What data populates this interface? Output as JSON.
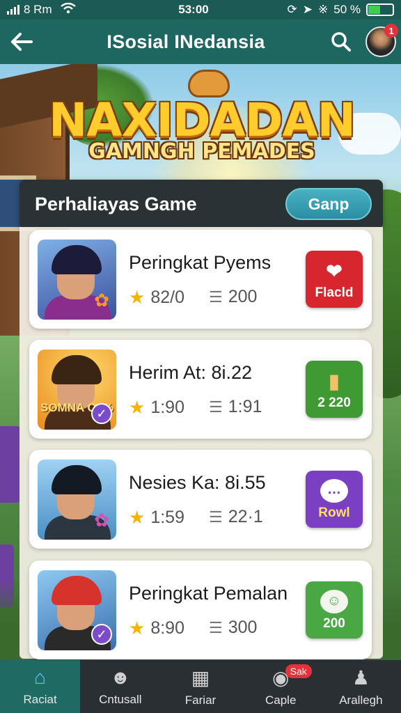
{
  "status_bar": {
    "carrier": "8 Rm",
    "time": "53:00",
    "battery": "50 %",
    "battery_level": 0.5
  },
  "app_bar": {
    "title": "ISosial INedansia",
    "notification_count": "1"
  },
  "banner": {
    "title": "NAXIDADAN",
    "subtitle": "GAMNGH PEMADES"
  },
  "search": {
    "label": "Perhaliayas Game",
    "button": "Ganp"
  },
  "games": [
    {
      "title": "Peringkat Pyems",
      "rating": "82/0",
      "count": "200",
      "action_label": "Flacld",
      "action_color": "#d8262e",
      "thumb_caption": ""
    },
    {
      "title": "Herim At: 8i.22",
      "rating": "1:90",
      "count": "1:91",
      "action_label": "2 220",
      "action_color": "#3f9a34",
      "thumb_caption": "SOMNA O1%"
    },
    {
      "title": "Nesies Ka: 8i.55",
      "rating": "1:59",
      "count": "22·1",
      "action_label": "Rowl",
      "action_color": "#7b3fc4",
      "thumb_caption": ""
    },
    {
      "title": "Peringkat Pemalan",
      "rating": "8:90",
      "count": "300",
      "action_label": "200",
      "action_color": "#4aa844",
      "thumb_caption": ""
    }
  ],
  "bottom_nav": {
    "items": [
      {
        "label": "Raciat",
        "icon": "home-icon"
      },
      {
        "label": "Cntusall",
        "icon": "chat-icon"
      },
      {
        "label": "Fariar",
        "icon": "grid-icon"
      },
      {
        "label": "Caple",
        "icon": "gamepad-icon",
        "badge": "Sak"
      },
      {
        "label": "Arallegh",
        "icon": "profile-icon"
      }
    ]
  },
  "colors": {
    "header": "#1e6760",
    "accent": "#2a8ea2",
    "nav_bg": "#2a2f33"
  }
}
